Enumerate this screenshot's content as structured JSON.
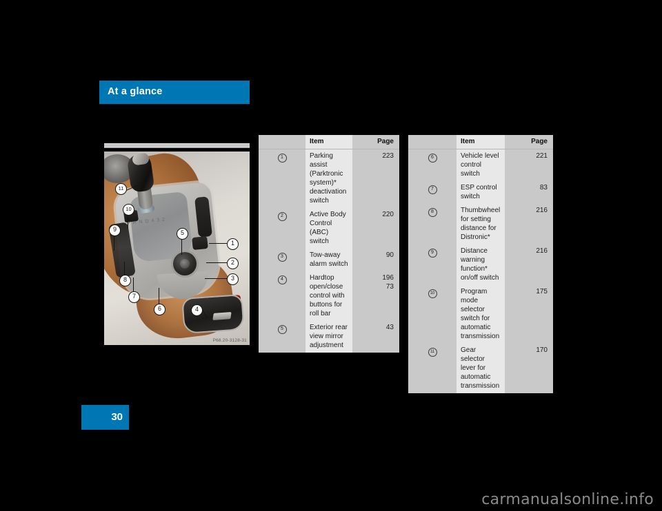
{
  "section": {
    "header_title": "At a glance",
    "page_number": "30"
  },
  "figure": {
    "caption_code": "P68.20-3128-31",
    "gate_pattern": "P R N D 4 3 2",
    "callouts": [
      {
        "id": "1",
        "label": "1"
      },
      {
        "id": "2",
        "label": "2"
      },
      {
        "id": "3",
        "label": "3"
      },
      {
        "id": "4",
        "label": "4"
      },
      {
        "id": "5",
        "label": "5"
      },
      {
        "id": "6",
        "label": "6"
      },
      {
        "id": "7",
        "label": "7"
      },
      {
        "id": "8",
        "label": "8"
      },
      {
        "id": "9",
        "label": "9"
      },
      {
        "id": "10",
        "label": "10"
      },
      {
        "id": "11",
        "label": "11"
      }
    ]
  },
  "tables": {
    "left": {
      "headers": {
        "num": "",
        "item": "Item",
        "page": "Page"
      },
      "rows": [
        {
          "num": "1",
          "item": "Parking assist (Parktronic system)* deactivation switch",
          "page": "223"
        },
        {
          "num": "2",
          "item": "Active Body Control (ABC) switch",
          "page": "220"
        },
        {
          "num": "3",
          "item": "Tow-away alarm switch",
          "page": "90"
        },
        {
          "num": "4",
          "item": "Hardtop open/close control with buttons for roll bar",
          "page": "196\n73"
        },
        {
          "num": "5",
          "item": "Exterior rear view mirror adjustment",
          "page": "43"
        }
      ]
    },
    "right": {
      "headers": {
        "num": "",
        "item": "Item",
        "page": "Page"
      },
      "rows": [
        {
          "num": "6",
          "item": "Vehicle level control switch",
          "page": "221"
        },
        {
          "num": "7",
          "item": "ESP control switch",
          "page": "83"
        },
        {
          "num": "8",
          "item": "Thumbwheel for setting distance for Distronic*",
          "page": "216"
        },
        {
          "num": "9",
          "item": "Distance warning function* on/off switch",
          "page": "216"
        },
        {
          "num": "10",
          "item": "Program mode selector switch for automatic transmission",
          "page": "175"
        },
        {
          "num": "11",
          "item": "Gear selector lever for automatic transmission",
          "page": "170"
        }
      ]
    }
  },
  "watermark": {
    "text": "carmanualsonline.info"
  },
  "colors": {
    "brand_blue": "#0077b5",
    "table_body_bg": "#e8e8e8",
    "table_gutter_bg": "#c9c9c9",
    "page_bg": "#000000"
  }
}
